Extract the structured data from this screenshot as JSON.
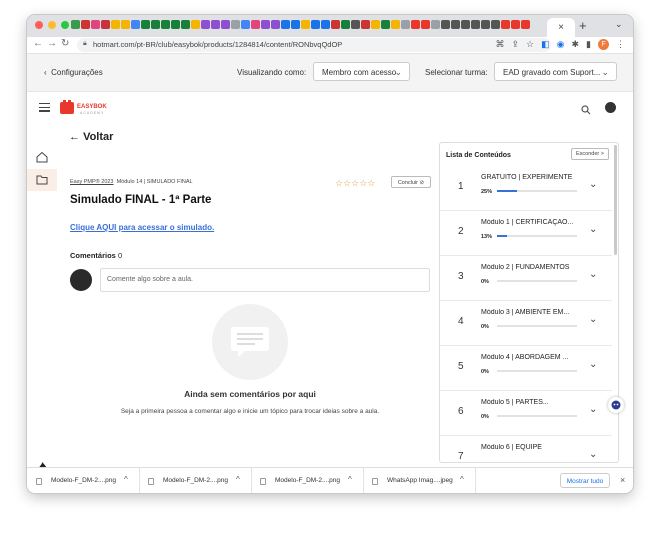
{
  "browser": {
    "url": "hotmart.com/pt-BR/club/easybok/products/1284814/content/RONbvqQdOP",
    "active_tab_close": "×",
    "new_tab": "+",
    "tab_menu": "⌄",
    "profile_initial": "F"
  },
  "config_bar": {
    "back_label": "Configurações",
    "viewing_label": "Visualizando como:",
    "viewing_value": "Membro com acesso",
    "turma_label": "Selecionar turma:",
    "turma_value": "EAD gravado com Suport..."
  },
  "logo": {
    "top": "EASYBOK",
    "bottom": "ACADEMY",
    "color": "#e8382b"
  },
  "lesson": {
    "back_label": "Voltar",
    "breadcrumb_course": "Easy PMP® 2023",
    "breadcrumb_rest": "Módulo 14 | SIMULADO FINAL",
    "concluir_label": "Concluir",
    "title": "Simulado FINAL - 1ª Parte",
    "link_text": "Clique AQUI para acessar o simulado.",
    "comments_label": "Comentários",
    "comments_count": "0",
    "comment_placeholder": "Comente algo sobre a aula.",
    "empty_title": "Ainda sem comentários por aqui",
    "empty_subtitle": "Seja a primeira pessoa a comentar algo e inicie um tópico para trocar ideias sobre a aula.",
    "stars": "☆☆☆☆☆",
    "rating": 0,
    "rating_max": 5
  },
  "content_list": {
    "title": "Lista de Conteúdos",
    "hide_label": "Esconder",
    "modules": [
      {
        "num": "1",
        "name": "GRATUITO | EXPERIMENTE",
        "pct": "25%",
        "progress": 25
      },
      {
        "num": "2",
        "name": "Módulo 1 | CERTIFICAÇÃO...",
        "pct": "13%",
        "progress": 13
      },
      {
        "num": "3",
        "name": "Módulo 2 | FUNDAMENTOS",
        "pct": "0%",
        "progress": 0
      },
      {
        "num": "4",
        "name": "Módulo 3 | AMBIENTE EM...",
        "pct": "0%",
        "progress": 0
      },
      {
        "num": "5",
        "name": "Módulo 4 | ABORDAGEM ...",
        "pct": "0%",
        "progress": 0
      },
      {
        "num": "6",
        "name": "Módulo 5 | PARTES...",
        "pct": "0%",
        "progress": 0
      },
      {
        "num": "7",
        "name": "Módulo 6 | EQUIPE",
        "pct": "",
        "progress": 0
      }
    ]
  },
  "downloads": {
    "items": [
      {
        "name": "Modelo-F_DM-2....png"
      },
      {
        "name": "Modelo-F_DM-2....png"
      },
      {
        "name": "Modelo-F_DM-2....png"
      },
      {
        "name": "WhatsApp Imag....jpeg"
      }
    ],
    "show_all": "Mostrar tudo",
    "close": "×"
  },
  "colors": {
    "accent": "#3a6fd8",
    "brand": "#e8382b",
    "star": "#e0a23a"
  }
}
